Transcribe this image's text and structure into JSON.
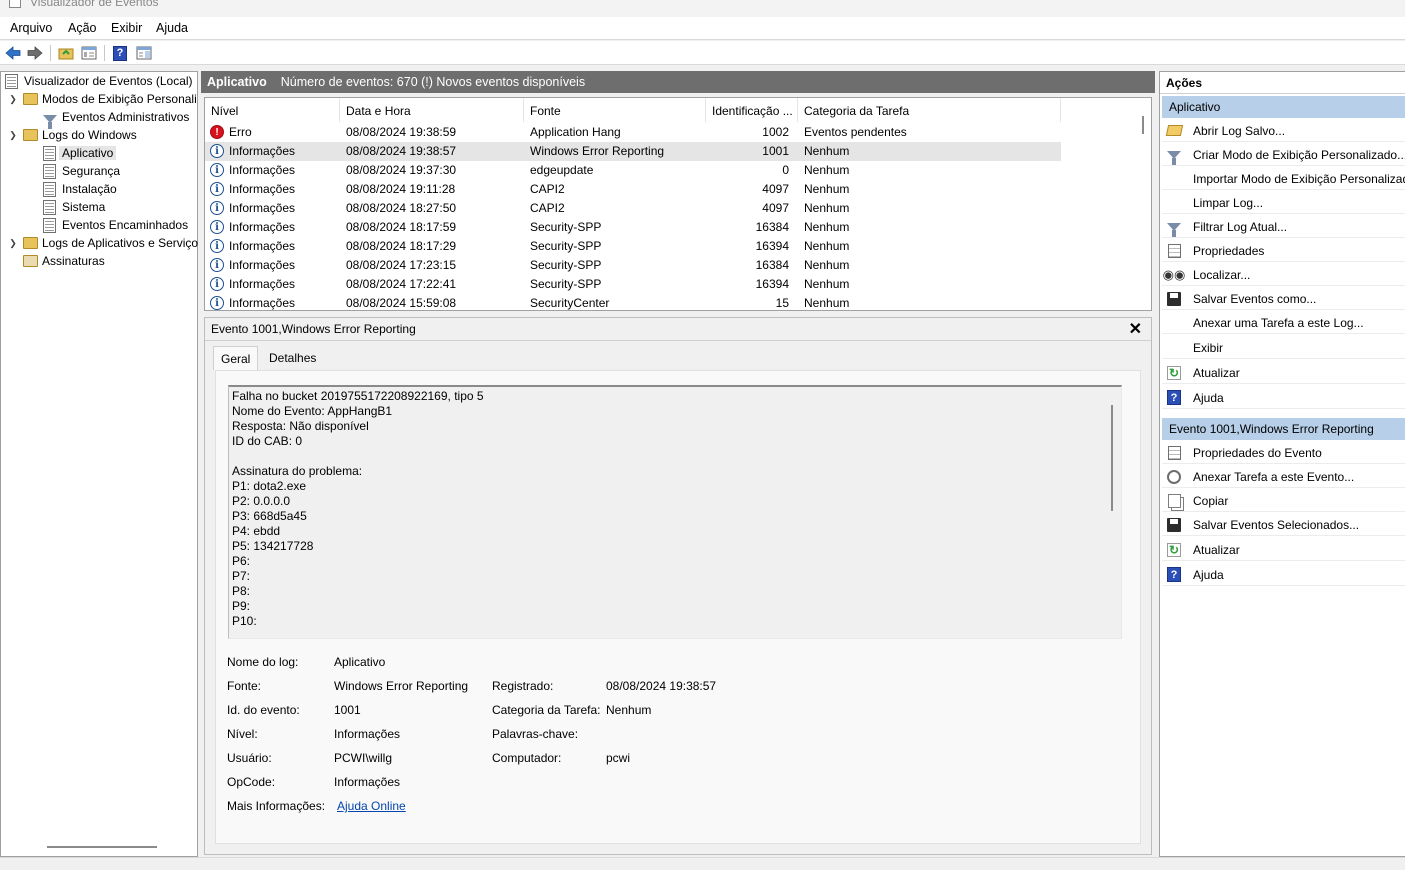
{
  "window": {
    "title": "Visualizador de Eventos"
  },
  "menu": [
    "Arquivo",
    "Ação",
    "Exibir",
    "Ajuda"
  ],
  "tree": {
    "root": "Visualizador de Eventos (Local)",
    "custom_views": "Modos de Exibição Personali",
    "admin_events": "Eventos Administrativos",
    "windows_logs": "Logs do Windows",
    "application": "Aplicativo",
    "security": "Segurança",
    "setup": "Instalação",
    "system": "Sistema",
    "forwarded": "Eventos Encaminhados",
    "app_services_logs": "Logs de Aplicativos e Serviço",
    "subscriptions": "Assinaturas"
  },
  "center_header": {
    "title": "Aplicativo",
    "info": "Número de eventos: 670 (!) Novos eventos disponíveis"
  },
  "columns": [
    "Nível",
    "Data e Hora",
    "Fonte",
    "Identificação ...",
    "Categoria da Tarefa"
  ],
  "events": [
    {
      "level": "Erro",
      "level_icon": "error-icon",
      "datetime": "08/08/2024 19:38:59",
      "source": "Application Hang",
      "id": "1002",
      "category": "Eventos pendentes"
    },
    {
      "level": "Informações",
      "level_icon": "info-icon",
      "datetime": "08/08/2024 19:38:57",
      "source": "Windows Error Reporting",
      "id": "1001",
      "category": "Nenhum",
      "selected": true
    },
    {
      "level": "Informações",
      "level_icon": "info-icon",
      "datetime": "08/08/2024 19:37:30",
      "source": "edgeupdate",
      "id": "0",
      "category": "Nenhum"
    },
    {
      "level": "Informações",
      "level_icon": "info-icon",
      "datetime": "08/08/2024 19:11:28",
      "source": "CAPI2",
      "id": "4097",
      "category": "Nenhum"
    },
    {
      "level": "Informações",
      "level_icon": "info-icon",
      "datetime": "08/08/2024 18:27:50",
      "source": "CAPI2",
      "id": "4097",
      "category": "Nenhum"
    },
    {
      "level": "Informações",
      "level_icon": "info-icon",
      "datetime": "08/08/2024 18:17:59",
      "source": "Security-SPP",
      "id": "16384",
      "category": "Nenhum"
    },
    {
      "level": "Informações",
      "level_icon": "info-icon",
      "datetime": "08/08/2024 18:17:29",
      "source": "Security-SPP",
      "id": "16394",
      "category": "Nenhum"
    },
    {
      "level": "Informações",
      "level_icon": "info-icon",
      "datetime": "08/08/2024 17:23:15",
      "source": "Security-SPP",
      "id": "16384",
      "category": "Nenhum"
    },
    {
      "level": "Informações",
      "level_icon": "info-icon",
      "datetime": "08/08/2024 17:22:41",
      "source": "Security-SPP",
      "id": "16394",
      "category": "Nenhum"
    },
    {
      "level": "Informações",
      "level_icon": "info-icon",
      "datetime": "08/08/2024 15:59:08",
      "source": "SecurityCenter",
      "id": "15",
      "category": "Nenhum"
    }
  ],
  "detail": {
    "title": "Evento 1001,Windows Error Reporting",
    "tabs": [
      "Geral",
      "Detalhes"
    ],
    "description": [
      "Falha no bucket 2019755172208922169, tipo 5",
      "Nome do Evento: AppHangB1",
      "Resposta: Não disponível",
      "ID do CAB: 0",
      "",
      "Assinatura do problema:",
      "P1: dota2.exe",
      "P2: 0.0.0.0",
      "P3: 668d5a45",
      "P4: ebdd",
      "P5: 134217728",
      "P6:",
      "P7:",
      "P8:",
      "P9:",
      "P10:"
    ],
    "props": {
      "log_name_label": "Nome do log:",
      "log_name": "Aplicativo",
      "source_label": "Fonte:",
      "source": "Windows Error Reporting",
      "logged_label": "Registrado:",
      "logged": "08/08/2024 19:38:57",
      "event_id_label": "Id. do evento:",
      "event_id": "1001",
      "task_category_label": "Categoria da Tarefa:",
      "task_category": "Nenhum",
      "level_label": "Nível:",
      "level": "Informações",
      "keywords_label": "Palavras-chave:",
      "keywords": "",
      "user_label": "Usuário:",
      "user": "PCWI\\willg",
      "computer_label": "Computador:",
      "computer": "pcwi",
      "opcode_label": "OpCode:",
      "opcode": "Informações",
      "more_info_label": "Mais Informações:",
      "more_info_link": "Ajuda Online"
    }
  },
  "actions": {
    "header": "Ações",
    "section1": {
      "title": "Aplicativo",
      "items": [
        {
          "label": "Abrir Log Salvo...",
          "icon": "open-folder-icon"
        },
        {
          "label": "Criar Modo de Exibição Personalizado...",
          "icon": "filter-icon"
        },
        {
          "label": "Importar Modo de Exibição Personalizado...",
          "icon": ""
        },
        {
          "label": "Limpar Log...",
          "icon": ""
        },
        {
          "label": "Filtrar Log Atual...",
          "icon": "filter-icon"
        },
        {
          "label": "Propriedades",
          "icon": "properties-icon"
        },
        {
          "label": "Localizar...",
          "icon": "binoculars-icon"
        },
        {
          "label": "Salvar Eventos como...",
          "icon": "save-icon"
        },
        {
          "label": "Anexar uma Tarefa a este Log...",
          "icon": ""
        },
        {
          "label": "Exibir",
          "icon": ""
        },
        {
          "label": "Atualizar",
          "icon": "refresh-icon"
        },
        {
          "label": "Ajuda",
          "icon": "help-icon"
        }
      ]
    },
    "section2": {
      "title": "Evento 1001,Windows Error Reporting",
      "items": [
        {
          "label": "Propriedades do Evento",
          "icon": "properties-icon"
        },
        {
          "label": "Anexar Tarefa a este Evento...",
          "icon": "clock-icon"
        },
        {
          "label": "Copiar",
          "icon": "copy-icon"
        },
        {
          "label": "Salvar Eventos Selecionados...",
          "icon": "save-icon"
        },
        {
          "label": "Atualizar",
          "icon": "refresh-icon"
        },
        {
          "label": "Ajuda",
          "icon": "help-icon"
        }
      ]
    }
  }
}
